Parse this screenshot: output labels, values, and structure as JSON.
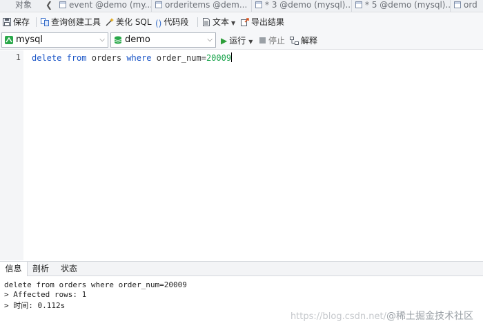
{
  "tabs": [
    {
      "label": "对象",
      "icon": "none"
    },
    {
      "label": "event @demo (my...",
      "icon": "table-icon"
    },
    {
      "label": "orderitems @dem...",
      "icon": "table-icon"
    },
    {
      "label": "* 3 @demo (mysql)...",
      "icon": "query-icon"
    },
    {
      "label": "* 5 @demo (mysql)...",
      "icon": "query-icon"
    },
    {
      "label": "ord",
      "icon": "table-icon"
    }
  ],
  "toolbar": {
    "save": "保存",
    "query_builder": "查询创建工具",
    "beautify": "美化 SQL",
    "snippet": "代码段",
    "text": "文本",
    "export": "导出结果"
  },
  "connection": {
    "server": "mysql",
    "database": "demo",
    "run": "运行",
    "stop": "停止",
    "explain": "解释"
  },
  "editor": {
    "line_number": "1",
    "tokens": {
      "kw1": "delete",
      "kw2": "from",
      "ident1": "orders",
      "kw3": "where",
      "ident2": "order_num=",
      "num": "20009"
    }
  },
  "bottom": {
    "tabs": [
      "信息",
      "剖析",
      "状态"
    ],
    "output": [
      "delete from orders where order_num=20009",
      "> Affected rows: 1",
      "> 时间: 0.112s"
    ]
  },
  "watermark": {
    "url": "https://blog.csdn.net/",
    "brand": "@稀土掘金技术社区"
  },
  "colors": {
    "keyword": "#1a55c7",
    "number": "#17a34a",
    "run_green": "#2e9e3a",
    "db_green": "#2aa84a"
  }
}
